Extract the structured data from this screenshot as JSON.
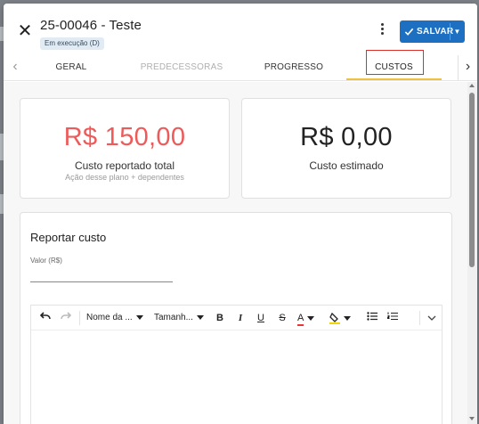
{
  "dialog": {
    "title": "25-00046 - Teste",
    "status_badge": "Em execução (D)",
    "save_label": "SALVAR"
  },
  "tabs": [
    {
      "label": "GERAL",
      "state": "normal"
    },
    {
      "label": "PREDECESSORAS",
      "state": "disabled"
    },
    {
      "label": "PROGRESSO",
      "state": "normal"
    },
    {
      "label": "CUSTOS",
      "state": "active"
    }
  ],
  "costs": {
    "reported": {
      "value": "R$ 150,00",
      "label": "Custo reportado total",
      "sublabel": "Ação desse plano + dependentes"
    },
    "estimated": {
      "value": "R$ 0,00",
      "label": "Custo estimado"
    }
  },
  "report": {
    "title": "Reportar custo",
    "value_label": "Valor (R$)",
    "value": ""
  },
  "editor_toolbar": {
    "font_name": "Nome da ...",
    "font_size": "Tamanh..."
  },
  "colors": {
    "accent": "#1d6fc2",
    "reported_value": "#ee5a5a",
    "active_tab_underline": "#f0c040",
    "highlight": "#d9302c"
  },
  "icons": [
    "close-icon",
    "kebab-menu-icon",
    "check-icon",
    "chevron-down-icon",
    "chevron-left-icon",
    "chevron-right-icon",
    "undo-icon",
    "redo-icon",
    "bold-icon",
    "italic-icon",
    "underline-icon",
    "strikethrough-icon",
    "font-color-icon",
    "highlight-color-icon",
    "bulleted-list-icon",
    "numbered-list-icon"
  ]
}
